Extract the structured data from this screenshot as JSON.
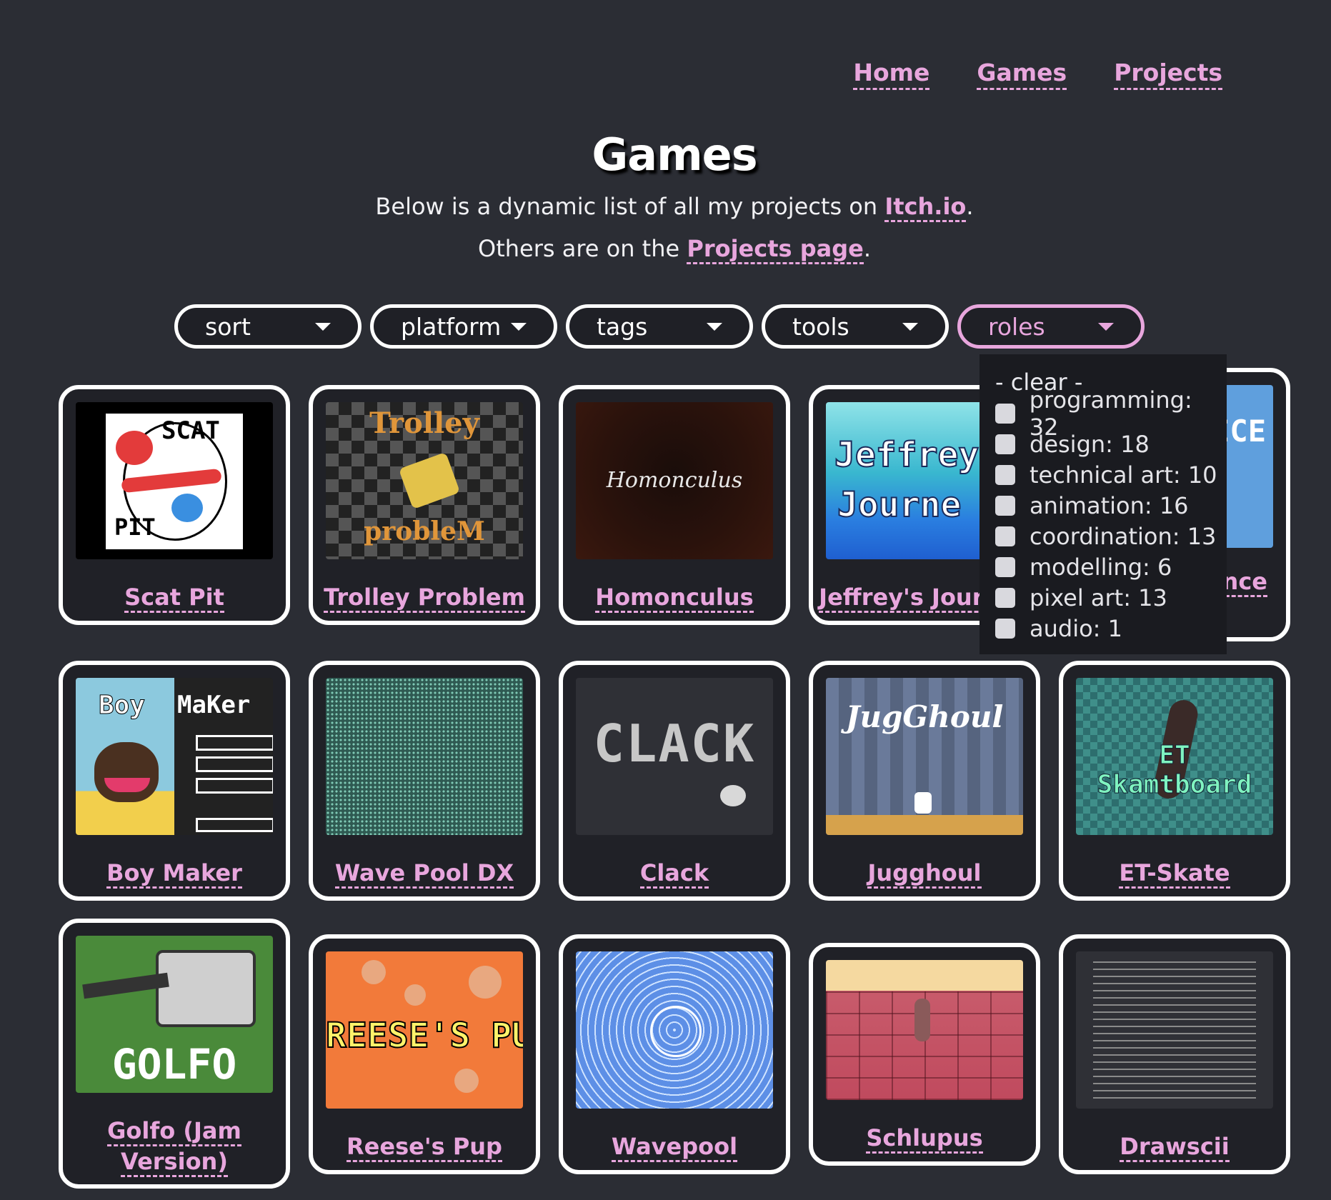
{
  "nav": {
    "home": "Home",
    "games": "Games",
    "projects": "Projects"
  },
  "header": {
    "title": "Games",
    "line1_pre": "Below is a dynamic list of all my projects on ",
    "line1_link": "Itch.io",
    "line1_post": ".",
    "line2_pre": "Others are on the ",
    "line2_link": "Projects page",
    "line2_post": "."
  },
  "filters": [
    "sort",
    "platform",
    "tags",
    "tools",
    "roles"
  ],
  "roles_dropdown": {
    "clear": "- clear -",
    "items": [
      "programming: 32",
      "design: 18",
      "technical art: 10",
      "animation: 16",
      "coordination: 13",
      "modelling: 6",
      "pixel art: 13",
      "audio: 1"
    ]
  },
  "games": [
    {
      "title": "Scat Pit",
      "thumb_text": [
        "SCAT",
        "PIT"
      ]
    },
    {
      "title": "Trolley Problem",
      "thumb_text": [
        "Trolley",
        "probleM"
      ]
    },
    {
      "title": "Homonculus",
      "thumb_text": [
        "Homonculus"
      ]
    },
    {
      "title": "Jeffrey's Journey",
      "thumb_text": [
        "Jeffrey",
        "Journe"
      ]
    },
    {
      "title": "Silence",
      "thumb_text": [
        "ICE"
      ]
    },
    {
      "title": "Boy Maker",
      "thumb_text": [
        "Boy",
        "MaKer"
      ]
    },
    {
      "title": "Wave Pool DX",
      "thumb_text": []
    },
    {
      "title": "Clack",
      "thumb_text": [
        "CLACK"
      ]
    },
    {
      "title": "Jugghoul",
      "thumb_text": [
        "JugGhoul"
      ]
    },
    {
      "title": "ET-Skate",
      "thumb_text": [
        "ET Skamtboard"
      ]
    },
    {
      "title": "Golfo (Jam Version)",
      "thumb_text": [
        "GOLFO"
      ]
    },
    {
      "title": "Reese's Pup",
      "thumb_text": [
        "REESE'S PUP"
      ]
    },
    {
      "title": "Wavepool",
      "thumb_text": []
    },
    {
      "title": "Schlupus",
      "thumb_text": []
    },
    {
      "title": "Drawscii",
      "thumb_text": []
    }
  ],
  "colors": {
    "background": "#2b2d34",
    "accent": "#e8a6dd",
    "card": "#202127"
  }
}
